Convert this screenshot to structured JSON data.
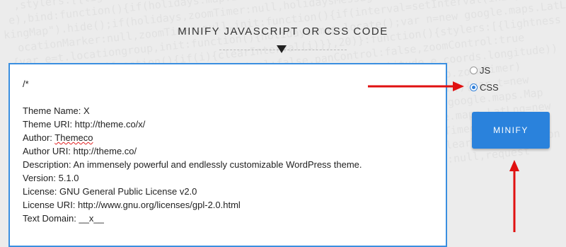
{
  "page": {
    "title": "MINIFY JAVASCRIPT OR CSS CODE"
  },
  "editor": {
    "lines": [
      "/*",
      "",
      "Theme Name: X",
      "Theme URI: http://theme.co/x/",
      "Author: Themeco",
      "Author URI: http://theme.co/",
      "Description: An immensely powerful and endlessly customizable WordPress theme.",
      "Version: 5.1.0",
      "License: GNU General Public License v2.0",
      "License URI: http://www.gnu.org/licenses/gpl-2.0.html",
      "Text Domain: __x__"
    ]
  },
  "options": {
    "js_label": "JS",
    "css_label": "CSS",
    "selected": "CSS"
  },
  "actions": {
    "minify_label": "MINIFY"
  },
  "colors": {
    "accent": "#2a82dc",
    "annotation_arrow": "#e01010",
    "editor_border": "#3a8fe0"
  }
}
